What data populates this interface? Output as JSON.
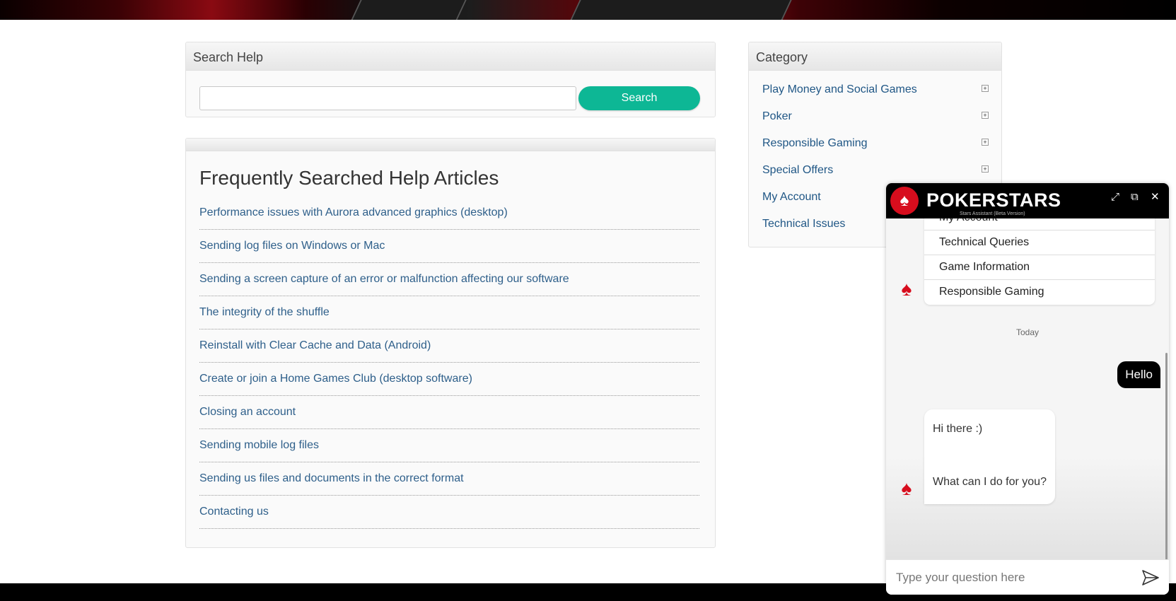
{
  "search_panel": {
    "title": "Search Help",
    "input_value": "",
    "button_label": "Search"
  },
  "faq": {
    "title": "Frequently Searched Help Articles",
    "articles": [
      "Performance issues with Aurora advanced graphics (desktop)",
      "Sending log files on Windows or Mac",
      "Sending a screen capture of an error or malfunction affecting our software",
      "The integrity of the shuffle",
      "Reinstall with Clear Cache and Data (Android)",
      "Create or join a Home Games Club (desktop software)",
      "Closing an account",
      "Sending mobile log files",
      "Sending us files and documents in the correct format",
      "Contacting us"
    ]
  },
  "category": {
    "title": "Category",
    "items": [
      {
        "label": "Play Money and Social Games",
        "expand": "+"
      },
      {
        "label": "Poker",
        "expand": "+"
      },
      {
        "label": "Responsible Gaming",
        "expand": "+"
      },
      {
        "label": "Special Offers",
        "expand": "+"
      },
      {
        "label": "My Account",
        "expand": "+"
      },
      {
        "label": "Technical Issues",
        "expand": "+"
      }
    ]
  },
  "chat": {
    "brand": "POKERSTARS",
    "subtitle": "Stars Assistant (Beta Version)",
    "expand_icon": "⤢",
    "restore_icon": "⧉",
    "close_icon": "✕",
    "menu_options": [
      "My Account",
      "Technical Queries",
      "Game Information",
      "Responsible Gaming"
    ],
    "date_divider": "Today",
    "user_message": "Hello",
    "bot_reply_line1": "Hi there :)",
    "bot_reply_line2": "What can I do for you?",
    "input_placeholder": "Type your question here",
    "brand_color": "#d70d1d"
  },
  "colors": {
    "search_button": "#0db795",
    "link": "#2e5f8a",
    "chat_header": "#000000"
  }
}
